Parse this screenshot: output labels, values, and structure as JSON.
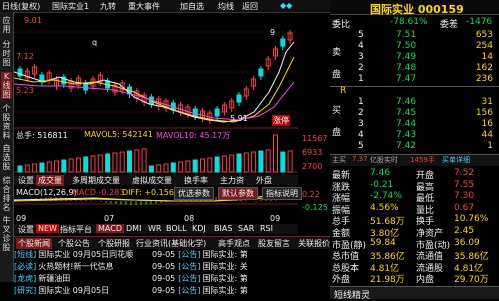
{
  "topbar": {
    "left_items": [
      "日线(复权)",
      "国际实业1"
    ],
    "menu": [
      "九转",
      "重大事件",
      "加自选",
      "均线",
      "返回"
    ]
  },
  "leftstrip": [
    "应用",
    "分时图",
    "K线图",
    "个股资料",
    "自选股",
    "综合排名",
    "牛叉诊股"
  ],
  "chart": {
    "price_labels": [
      "9.01",
      "7.12",
      "5.23"
    ],
    "low_marker": "5.91",
    "high_label": "9",
    "red_tag": "涨停",
    "q_mark": "q",
    "volume_line": {
      "total": "总手: 516811",
      "ma5": "MAVOL5: 542141",
      "ma10": "MAVOL10: 45.17万"
    },
    "volume_labels": [
      "11567",
      "6933",
      "2700"
    ],
    "tabs1": [
      "设置",
      "成交量",
      "多周期成交量",
      "虚拟成交量",
      "换手率",
      "主力资",
      "外盘"
    ],
    "macd_line": {
      "title": "MACD(12,26,9)",
      "macd": "MACD -0.283",
      "diff": "DIFF: +0.156"
    },
    "macd_buttons": [
      "优选参数",
      "默认参数",
      "指标说明"
    ],
    "macd_labels": [
      "0.22",
      "-0.125"
    ],
    "months": [
      "09",
      "07",
      "08",
      "09"
    ],
    "tabs2": [
      "设置",
      "NEW",
      "指标平台",
      "MACD",
      "DMI",
      "WR",
      "BOLL",
      "KDJ",
      "BIAS",
      "SAR",
      "RSI"
    ],
    "news_tabs": [
      "个股新闻",
      "个股公告",
      "个股研报",
      "行业资讯(基础化学)",
      "高手观点",
      "股友留言",
      "关联报价"
    ],
    "news_left": [
      {
        "tag": "[短线]",
        "text": "国际实业 09月05日同花顺"
      },
      {
        "tag": "[必读]",
        "text": "火热题材!新一代信息"
      },
      {
        "tag": "[龙虎]",
        "text": "新疆油田"
      },
      {
        "tag": "[研究]",
        "text": "国际实业 09月05日"
      }
    ],
    "news_right": [
      {
        "date": "09-05",
        "tag": "[公告]",
        "text": "国际实业: 第"
      },
      {
        "date": "09-05",
        "tag": "[公告]",
        "text": "国际实业: 关"
      },
      {
        "date": "09-05",
        "tag": "[公告]",
        "text": "国际实业: 第"
      },
      {
        "date": "09-05",
        "tag": "[公告]",
        "text": "国际实业: 第"
      }
    ]
  },
  "right": {
    "title": "国际实业 000159",
    "weibi_label": "委比",
    "weibi_val": "-78.61%",
    "weicha_label": "委差",
    "weicha_val": "-1476",
    "sell_label": "卖盘",
    "buy_label": "买盘",
    "sells": [
      {
        "lvl": "5",
        "price": "7.51",
        "vol": "653"
      },
      {
        "lvl": "4",
        "price": "7.50",
        "vol": "254"
      },
      {
        "lvl": "3",
        "price": "7.49",
        "vol": "14"
      },
      {
        "lvl": "2",
        "price": "7.48",
        "vol": "162"
      },
      {
        "lvl": "1",
        "price": "7.47",
        "vol": "236"
      }
    ],
    "buys": [
      {
        "lvl": "1",
        "price": "7.46",
        "vol": "31"
      },
      {
        "lvl": "2",
        "price": "7.45",
        "vol": "156"
      },
      {
        "lvl": "3",
        "price": "7.44",
        "vol": "16"
      },
      {
        "lvl": "4",
        "price": "7.43",
        "vol": "44"
      },
      {
        "lvl": "5",
        "price": "7.42",
        "vol": "1"
      }
    ],
    "r_label": "R",
    "bar_line": {
      "a": "主买",
      "b": "7.37",
      "c": "亿股实时",
      "d": "1459手",
      "e": "买单详细"
    },
    "stats": [
      {
        "l1": "最新",
        "v1": "7.46",
        "l2": "开盘",
        "v2": "7.52"
      },
      {
        "l1": "涨跌",
        "v1": "-0.21",
        "l2": "最高",
        "v2": "7.55"
      },
      {
        "l1": "涨幅",
        "v1": "-2.74%",
        "l2": "最低",
        "v2": "7.30"
      },
      {
        "l1": "振幅",
        "v1": "4.56%",
        "l2": "量比",
        "v2": "0.67"
      },
      {
        "l1": "总手",
        "v1": "51.68万",
        "l2": "换手",
        "v2": "10.76%"
      },
      {
        "l1": "金额",
        "v1": "3.80亿",
        "l2": "净资产",
        "v2": "2.45"
      },
      {
        "l1": "市盈(静)",
        "v1": "59.84",
        "l2": "市盈(动)",
        "v2": "36.09"
      },
      {
        "l1": "总市值",
        "v1": "35.86亿",
        "l2": "流通值",
        "v2": "35.86亿"
      },
      {
        "l1": "总股本",
        "v1": "4.81亿",
        "l2": "流通股",
        "v2": "4.81亿"
      },
      {
        "l1": "外盘",
        "v1": "21.98万",
        "l2": "内盘",
        "v2": "29.70万"
      }
    ],
    "footer": "短线精灵"
  }
}
